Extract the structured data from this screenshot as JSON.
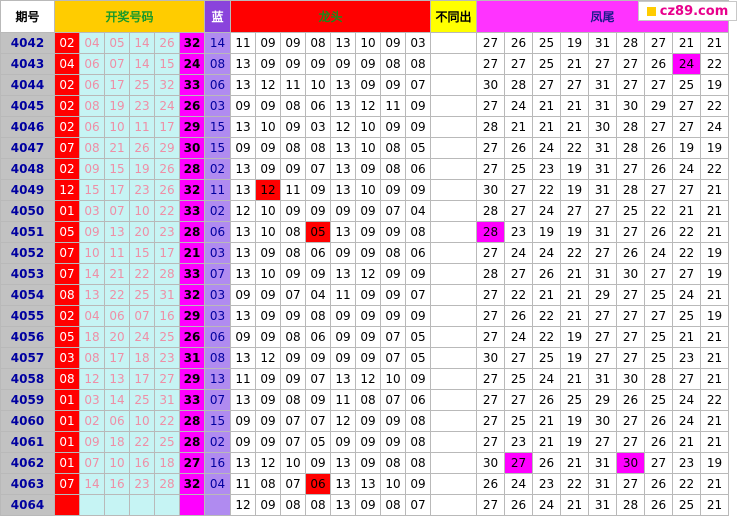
{
  "headers": {
    "period": "期号",
    "draw": "开奖号码",
    "blue": "蓝",
    "dragon": "龙头",
    "not_repeat": "不同出",
    "phoenix": "凤尾"
  },
  "logo": "cz89.com",
  "rows": [
    {
      "p": "4042",
      "r": [
        "02",
        "04",
        "05",
        "14",
        "26",
        "32"
      ],
      "b": "14",
      "d": [
        "11",
        "09",
        "09",
        "08",
        "13",
        "10",
        "09",
        "03"
      ],
      "f": [
        "27",
        "26",
        "25",
        "19",
        "31",
        "28",
        "27",
        "21",
        "21"
      ]
    },
    {
      "p": "4043",
      "r": [
        "04",
        "06",
        "07",
        "14",
        "15",
        "24"
      ],
      "b": "08",
      "d": [
        "13",
        "09",
        "09",
        "09",
        "09",
        "09",
        "08",
        "08"
      ],
      "f": [
        "27",
        "27",
        "25",
        "21",
        "27",
        "27",
        "26",
        "24",
        "22"
      ]
    },
    {
      "p": "4044",
      "r": [
        "02",
        "06",
        "17",
        "25",
        "32",
        "33"
      ],
      "b": "06",
      "d": [
        "13",
        "12",
        "11",
        "10",
        "13",
        "09",
        "09",
        "07"
      ],
      "f": [
        "30",
        "28",
        "27",
        "27",
        "31",
        "27",
        "27",
        "25",
        "19"
      ]
    },
    {
      "p": "4045",
      "r": [
        "02",
        "08",
        "19",
        "23",
        "24",
        "26"
      ],
      "b": "03",
      "d": [
        "09",
        "09",
        "08",
        "06",
        "13",
        "12",
        "11",
        "09"
      ],
      "f": [
        "27",
        "24",
        "21",
        "21",
        "31",
        "30",
        "29",
        "27",
        "22"
      ]
    },
    {
      "p": "4046",
      "r": [
        "02",
        "06",
        "10",
        "11",
        "17",
        "29"
      ],
      "b": "15",
      "d": [
        "13",
        "10",
        "09",
        "03",
        "12",
        "10",
        "09",
        "09"
      ],
      "f": [
        "28",
        "21",
        "21",
        "21",
        "30",
        "28",
        "27",
        "27",
        "24"
      ]
    },
    {
      "p": "4047",
      "r": [
        "07",
        "08",
        "21",
        "26",
        "29",
        "30"
      ],
      "b": "15",
      "d": [
        "09",
        "09",
        "08",
        "08",
        "13",
        "10",
        "08",
        "05"
      ],
      "f": [
        "27",
        "26",
        "24",
        "22",
        "31",
        "28",
        "26",
        "19",
        "19"
      ]
    },
    {
      "p": "4048",
      "r": [
        "02",
        "09",
        "15",
        "19",
        "26",
        "28"
      ],
      "b": "02",
      "d": [
        "13",
        "09",
        "09",
        "07",
        "13",
        "09",
        "08",
        "06"
      ],
      "f": [
        "27",
        "25",
        "23",
        "19",
        "31",
        "27",
        "26",
        "24",
        "22"
      ]
    },
    {
      "p": "4049",
      "r": [
        "12",
        "15",
        "17",
        "23",
        "26",
        "32"
      ],
      "b": "11",
      "d": [
        "13",
        "12",
        "11",
        "09",
        "13",
        "10",
        "09",
        "09"
      ],
      "f": [
        "30",
        "27",
        "22",
        "19",
        "31",
        "28",
        "27",
        "27",
        "21"
      ]
    },
    {
      "p": "4050",
      "r": [
        "01",
        "03",
        "07",
        "10",
        "22",
        "33"
      ],
      "b": "02",
      "d": [
        "12",
        "10",
        "09",
        "09",
        "09",
        "09",
        "07",
        "04"
      ],
      "f": [
        "28",
        "27",
        "24",
        "27",
        "27",
        "25",
        "22",
        "21",
        "21"
      ]
    },
    {
      "p": "4051",
      "r": [
        "05",
        "09",
        "13",
        "20",
        "23",
        "28"
      ],
      "b": "06",
      "d": [
        "13",
        "10",
        "08",
        "05",
        "13",
        "09",
        "09",
        "08"
      ],
      "f": [
        "28",
        "23",
        "19",
        "19",
        "31",
        "27",
        "26",
        "22",
        "21"
      ]
    },
    {
      "p": "4052",
      "r": [
        "07",
        "10",
        "11",
        "15",
        "17",
        "21"
      ],
      "b": "03",
      "d": [
        "13",
        "09",
        "08",
        "06",
        "09",
        "09",
        "08",
        "06"
      ],
      "f": [
        "27",
        "24",
        "24",
        "22",
        "27",
        "26",
        "24",
        "22",
        "19"
      ]
    },
    {
      "p": "4053",
      "r": [
        "07",
        "14",
        "21",
        "22",
        "28",
        "33"
      ],
      "b": "07",
      "d": [
        "13",
        "10",
        "09",
        "09",
        "13",
        "12",
        "09",
        "09"
      ],
      "f": [
        "28",
        "27",
        "26",
        "21",
        "31",
        "30",
        "27",
        "27",
        "19"
      ]
    },
    {
      "p": "4054",
      "r": [
        "08",
        "13",
        "22",
        "25",
        "31",
        "32"
      ],
      "b": "03",
      "d": [
        "09",
        "09",
        "07",
        "04",
        "11",
        "09",
        "09",
        "07"
      ],
      "f": [
        "27",
        "22",
        "21",
        "21",
        "29",
        "27",
        "25",
        "24",
        "21"
      ]
    },
    {
      "p": "4055",
      "r": [
        "02",
        "04",
        "06",
        "07",
        "16",
        "29"
      ],
      "b": "03",
      "d": [
        "13",
        "09",
        "09",
        "08",
        "09",
        "09",
        "09",
        "09"
      ],
      "f": [
        "27",
        "26",
        "22",
        "21",
        "27",
        "27",
        "27",
        "25",
        "19"
      ]
    },
    {
      "p": "4056",
      "r": [
        "05",
        "18",
        "20",
        "24",
        "25",
        "26"
      ],
      "b": "06",
      "d": [
        "09",
        "09",
        "08",
        "06",
        "09",
        "09",
        "07",
        "05"
      ],
      "f": [
        "27",
        "24",
        "22",
        "19",
        "27",
        "27",
        "25",
        "21",
        "21"
      ]
    },
    {
      "p": "4057",
      "r": [
        "03",
        "08",
        "17",
        "18",
        "23",
        "31"
      ],
      "b": "08",
      "d": [
        "13",
        "12",
        "09",
        "09",
        "09",
        "09",
        "07",
        "05"
      ],
      "f": [
        "30",
        "27",
        "25",
        "19",
        "27",
        "27",
        "25",
        "23",
        "21"
      ]
    },
    {
      "p": "4058",
      "r": [
        "08",
        "12",
        "13",
        "17",
        "27",
        "29"
      ],
      "b": "13",
      "d": [
        "11",
        "09",
        "09",
        "07",
        "13",
        "12",
        "10",
        "09"
      ],
      "f": [
        "27",
        "25",
        "24",
        "21",
        "31",
        "30",
        "28",
        "27",
        "21"
      ]
    },
    {
      "p": "4059",
      "r": [
        "01",
        "03",
        "14",
        "25",
        "31",
        "33"
      ],
      "b": "07",
      "d": [
        "13",
        "09",
        "08",
        "09",
        "11",
        "08",
        "07",
        "06"
      ],
      "f": [
        "27",
        "27",
        "26",
        "25",
        "29",
        "26",
        "25",
        "24",
        "22"
      ]
    },
    {
      "p": "4060",
      "r": [
        "01",
        "02",
        "06",
        "10",
        "22",
        "28"
      ],
      "b": "15",
      "d": [
        "09",
        "09",
        "07",
        "07",
        "12",
        "09",
        "09",
        "08"
      ],
      "f": [
        "27",
        "25",
        "21",
        "19",
        "30",
        "27",
        "26",
        "24",
        "21"
      ]
    },
    {
      "p": "4061",
      "r": [
        "01",
        "09",
        "18",
        "22",
        "25",
        "28"
      ],
      "b": "02",
      "d": [
        "09",
        "09",
        "07",
        "05",
        "09",
        "09",
        "09",
        "08"
      ],
      "f": [
        "27",
        "23",
        "21",
        "19",
        "27",
        "27",
        "26",
        "21",
        "21"
      ]
    },
    {
      "p": "4062",
      "r": [
        "01",
        "07",
        "10",
        "16",
        "18",
        "27"
      ],
      "b": "16",
      "d": [
        "13",
        "12",
        "10",
        "09",
        "13",
        "09",
        "08",
        "08"
      ],
      "f": [
        "30",
        "27",
        "26",
        "21",
        "31",
        "30",
        "27",
        "23",
        "19"
      ]
    },
    {
      "p": "4063",
      "r": [
        "07",
        "14",
        "16",
        "23",
        "28",
        "32"
      ],
      "b": "04",
      "d": [
        "11",
        "08",
        "07",
        "06",
        "13",
        "13",
        "10",
        "09"
      ],
      "f": [
        "26",
        "24",
        "23",
        "22",
        "31",
        "27",
        "26",
        "22",
        "21"
      ]
    },
    {
      "p": "4064",
      "r": [
        "",
        "",
        "",
        "",
        "",
        ""
      ],
      "b": "",
      "d": [
        "12",
        "09",
        "08",
        "08",
        "13",
        "09",
        "08",
        "07"
      ],
      "f": [
        "27",
        "26",
        "24",
        "21",
        "31",
        "28",
        "26",
        "25",
        "21"
      ]
    }
  ],
  "highlights": {
    "dragon_red": [
      [
        "4049",
        1
      ],
      [
        "4051",
        3
      ],
      [
        "4063",
        3
      ]
    ],
    "phoenix_magenta": [
      [
        "4043",
        7
      ],
      [
        "4051",
        0
      ],
      [
        "4062",
        1
      ],
      [
        "4062",
        5
      ]
    ]
  }
}
